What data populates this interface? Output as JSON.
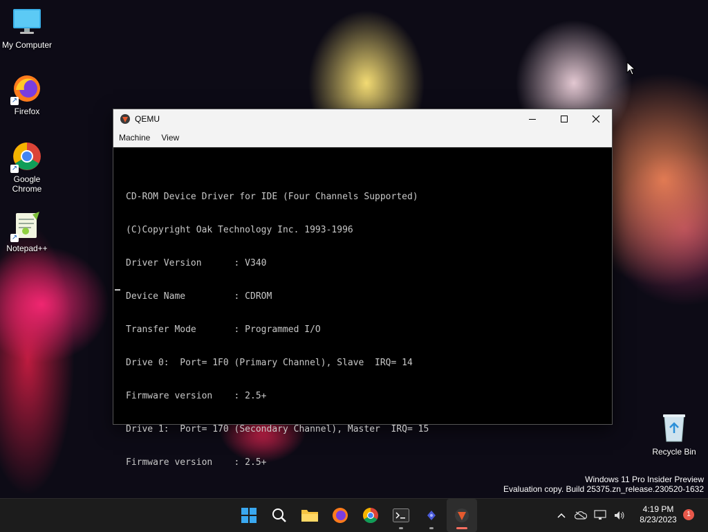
{
  "desktop": {
    "icons": [
      {
        "label": "My Computer"
      },
      {
        "label": "Firefox"
      },
      {
        "label": "Google Chrome"
      },
      {
        "label": "Notepad++"
      }
    ],
    "recycle_bin": {
      "label": "Recycle Bin"
    }
  },
  "window": {
    "title": "QEMU",
    "menu": [
      "Machine",
      "View"
    ],
    "console_lines": [
      "CD-ROM Device Driver for IDE (Four Channels Supported)",
      "(C)Copyright Oak Technology Inc. 1993-1996",
      "Driver Version      : V340",
      "Device Name         : CDROM",
      "Transfer Mode       : Programmed I/O",
      "Drive 0:  Port= 1F0 (Primary Channel), Slave  IRQ= 14",
      "Firmware version    : 2.5+",
      "Drive 1:  Port= 170 (Secondary Channel), Master  IRQ= 15",
      "Firmware version    : 2.5+"
    ]
  },
  "watermark": {
    "line1": "Windows 11 Pro Insider Preview",
    "line2": "Evaluation copy. Build 25375.zn_release.230520-1632"
  },
  "taskbar": {
    "apps": [
      "start-icon",
      "search-icon",
      "file-explorer-icon",
      "firefox-icon",
      "chrome-icon",
      "terminal-icon",
      "app-icon",
      "qemu-icon"
    ],
    "clock": {
      "time": "4:19 PM",
      "date": "8/23/2023"
    },
    "notification_count": "1"
  },
  "colors": {
    "taskbar_bg": "#1c1c1c",
    "titlebar_bg": "#f3f3f3",
    "console_text": "#c8c8c8",
    "accent": "#ff6f61"
  }
}
